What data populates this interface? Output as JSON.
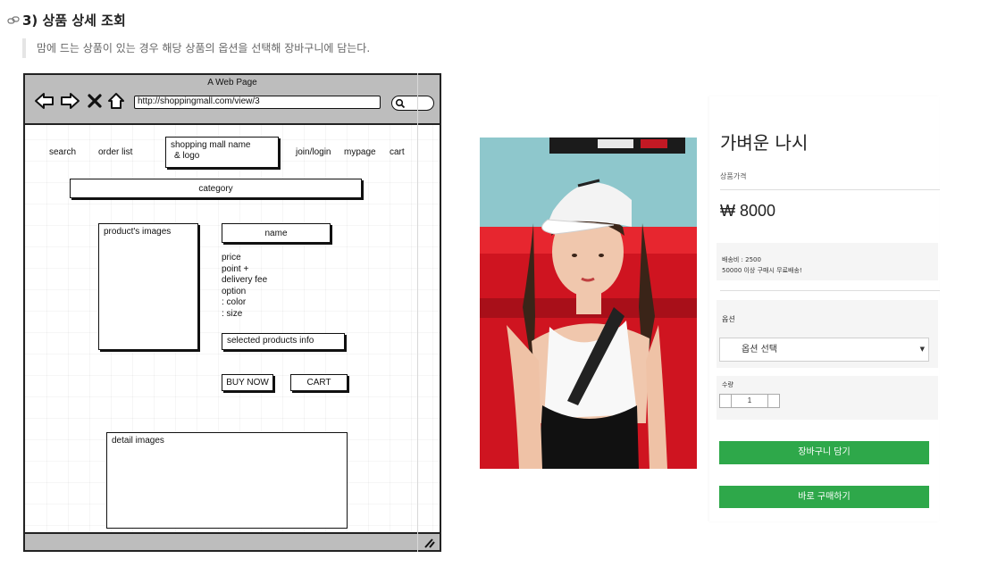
{
  "heading": {
    "icon": "link-icon",
    "title": "3) 상품 상세 조회"
  },
  "description": "맘에 드는 상품이 있는 경우 해당 상품의 옵션을 선택해 장바구니에 담는다.",
  "wireframe": {
    "window_title": "A Web Page",
    "url": "http://shoppingmall.com/view/3",
    "nav": {
      "search": "search",
      "order_list": "order list",
      "logo_line1": "shopping mall name",
      "logo_line2": "& logo",
      "join_login": "join/login",
      "mypage": "mypage",
      "cart": "cart"
    },
    "category": "category",
    "product_images": "product's images",
    "name": "name",
    "specs": [
      "price",
      "point +",
      "delivery fee",
      "option",
      ": color",
      ": size"
    ],
    "selected_info": "selected products info",
    "buy_now": "BUY NOW",
    "cart_button": "CART",
    "detail_images": "detail images"
  },
  "product": {
    "name": "가벼운 나시",
    "price_label": "상품가격",
    "currency": "₩",
    "price": "8000",
    "shipping_fee": "배송비 : 2500",
    "shipping_note": "50000 이상 구매시 무료배송!",
    "option_label": "옵션",
    "option_placeholder": "옵션 선택",
    "quantity_label": "수량",
    "quantity_value": "1",
    "add_to_cart": "장바구니 담기",
    "buy_now": "바로 구매하기",
    "button_color": "#2ea84a"
  }
}
